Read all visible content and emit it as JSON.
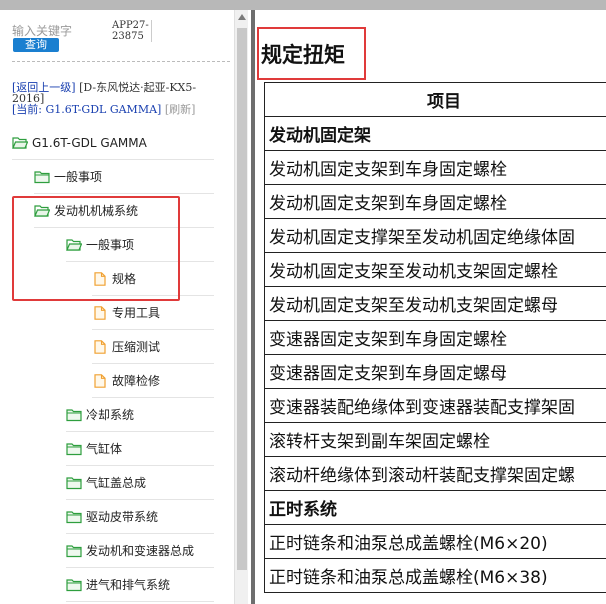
{
  "search": {
    "placeholder": "输入关键字",
    "button_label": "查询"
  },
  "app_id": [
    "APP27-",
    "23875"
  ],
  "breadcrumb": {
    "back_link": "[返回上一级]",
    "vehicle": "[D-东风悦达·起亚-KX5-2016]",
    "current_prefix": "[当前:",
    "current_value": "G1.6T-GDL GAMMA]",
    "refresh": "[刷新]"
  },
  "tree": [
    {
      "label": "G1.6T-GDL GAMMA",
      "icon": "folder-open-icon",
      "level": 0
    },
    {
      "label": "一般事项",
      "icon": "folder-icon",
      "level": 1
    },
    {
      "label": "发动机机械系统",
      "icon": "folder-open-icon",
      "level": 1
    },
    {
      "label": "一般事项",
      "icon": "folder-open-icon",
      "level": 2
    },
    {
      "label": "规格",
      "icon": "document-icon",
      "level": 3
    },
    {
      "label": "专用工具",
      "icon": "document-icon",
      "level": 3
    },
    {
      "label": "压缩测试",
      "icon": "document-icon",
      "level": 3
    },
    {
      "label": "故障检修",
      "icon": "document-icon",
      "level": 3
    },
    {
      "label": "冷却系统",
      "icon": "folder-icon",
      "level": 2
    },
    {
      "label": "气缸体",
      "icon": "folder-icon",
      "level": 2
    },
    {
      "label": "气缸盖总成",
      "icon": "folder-icon",
      "level": 2
    },
    {
      "label": "驱动皮带系统",
      "icon": "folder-icon",
      "level": 2
    },
    {
      "label": "发动机和变速器总成",
      "icon": "folder-icon",
      "level": 2
    },
    {
      "label": "进气和排气系统",
      "icon": "folder-icon",
      "level": 2
    }
  ],
  "content": {
    "title": "规定扭矩",
    "table_header": "项目",
    "rows": [
      {
        "text": "发动机固定架",
        "section": true
      },
      {
        "text": "发动机固定支架到车身固定螺栓",
        "section": false
      },
      {
        "text": "发动机固定支架到车身固定螺栓",
        "section": false
      },
      {
        "text": "发动机固定支撑架至发动机固定绝缘体固",
        "section": false
      },
      {
        "text": "发动机固定支架至发动机支架固定螺栓",
        "section": false
      },
      {
        "text": "发动机固定支架至发动机支架固定螺母",
        "section": false
      },
      {
        "text": "变速器固定支架到车身固定螺栓",
        "section": false
      },
      {
        "text": "变速器固定支架到车身固定螺母",
        "section": false
      },
      {
        "text": "变速器装配绝缘体到变速器装配支撑架固",
        "section": false
      },
      {
        "text": "滚转杆支架到副车架固定螺栓",
        "section": false
      },
      {
        "text": "滚动杆绝缘体到滚动杆装配支撑架固定螺",
        "section": false
      },
      {
        "text": "正时系统",
        "section": true
      },
      {
        "text": "正时链条和油泵总成盖螺栓(M6×20)",
        "section": false
      },
      {
        "text": "正时链条和油泵总成盖螺栓(M6×38)",
        "section": false
      }
    ]
  },
  "colors": {
    "accent_blue": "#1a7fd0",
    "highlight_red": "#e03a3a",
    "folder_green": "#2e9e3e",
    "document_orange": "#f0a030",
    "link_blue": "#1a40b0"
  }
}
